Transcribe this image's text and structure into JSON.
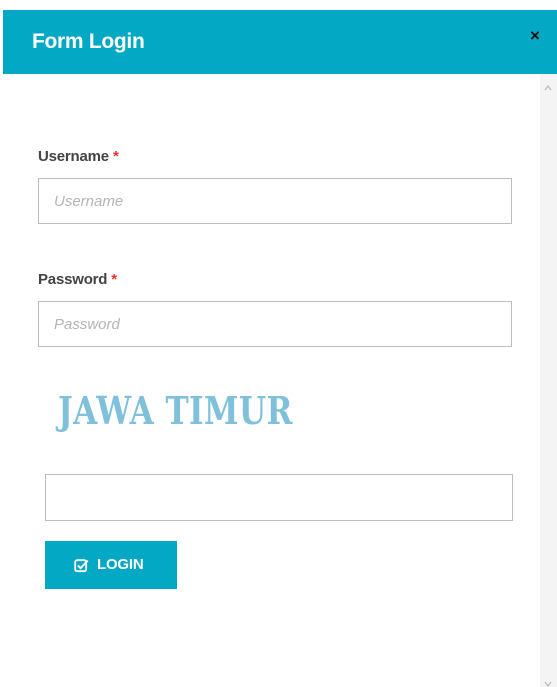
{
  "dialog": {
    "title": "Form Login",
    "close_icon": "close-icon",
    "close_symbol": "×"
  },
  "form": {
    "username": {
      "label": "Username",
      "required_mark": "*",
      "placeholder": "Username",
      "value": ""
    },
    "password": {
      "label": "Password",
      "required_mark": "*",
      "placeholder": "Password",
      "value": ""
    },
    "captcha": {
      "image_text": "JAWA TIMUR",
      "value": ""
    },
    "login_button": {
      "label": "LOGIN",
      "icon": "check-square-icon"
    }
  },
  "colors": {
    "accent": "#03a8c4",
    "required": "#e4322f",
    "captcha_text": "#7fc0da"
  }
}
